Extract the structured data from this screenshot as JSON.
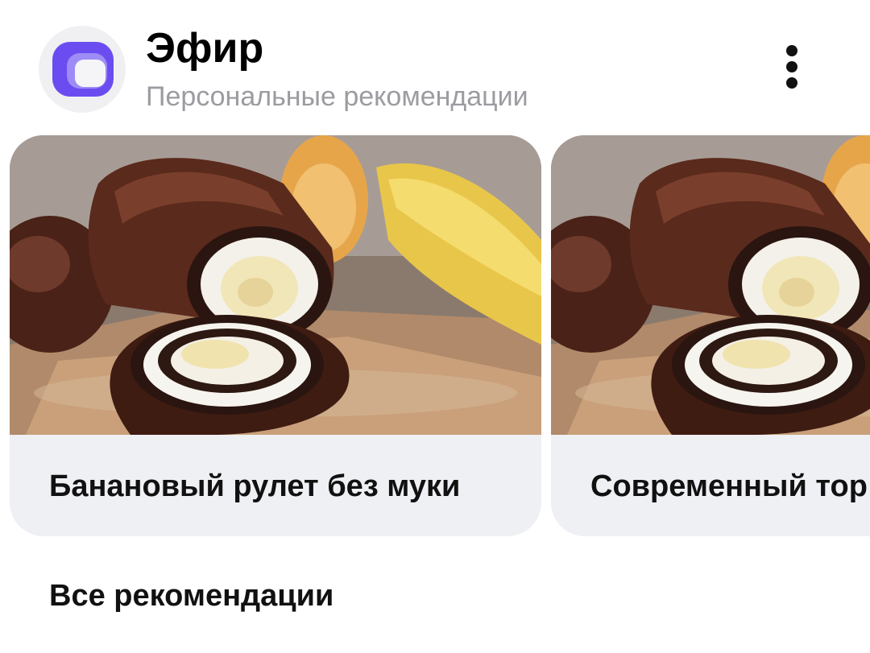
{
  "header": {
    "title": "Эфир",
    "subtitle": "Персональные рекомендации",
    "logo_icon": "efir-logo-icon",
    "menu_icon": "more-vertical-icon"
  },
  "cards": [
    {
      "title": "Банановый рулет без муки",
      "image": "chocolate-banana-roll-photo"
    },
    {
      "title": "Современный тор",
      "image": "chocolate-banana-roll-photo"
    }
  ],
  "footer": {
    "all_recommendations_label": "Все рекомендации"
  },
  "colors": {
    "brand_purple": "#6b4cf0",
    "brand_purple_light": "#9d8cf5",
    "card_background": "#eff0f4",
    "subtitle_gray": "#9b9ba1",
    "text_dark": "#111111"
  }
}
